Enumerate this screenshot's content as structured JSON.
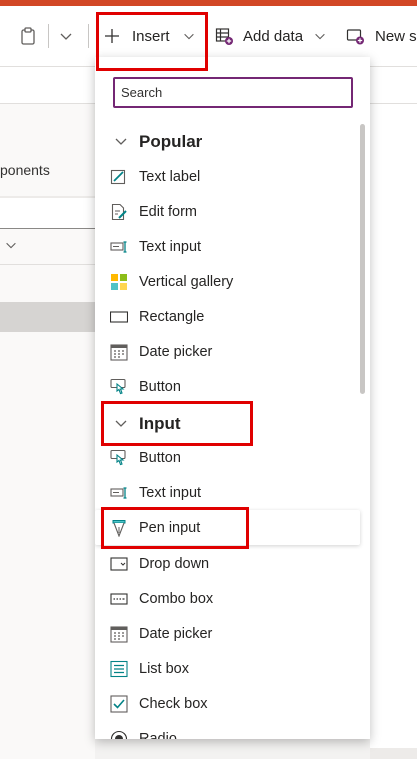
{
  "toolbar": {
    "insert_label": "Insert",
    "add_data_label": "Add data",
    "new_screen_label": "New s"
  },
  "left_panel": {
    "tab_label": "ponents"
  },
  "insert_menu": {
    "search_placeholder": "Search",
    "groups": [
      {
        "label": "Popular",
        "items": [
          {
            "label": "Text label",
            "icon": "text-label-icon"
          },
          {
            "label": "Edit form",
            "icon": "edit-form-icon"
          },
          {
            "label": "Text input",
            "icon": "text-input-icon"
          },
          {
            "label": "Vertical gallery",
            "icon": "vertical-gallery-icon"
          },
          {
            "label": "Rectangle",
            "icon": "rectangle-icon"
          },
          {
            "label": "Date picker",
            "icon": "date-picker-icon"
          },
          {
            "label": "Button",
            "icon": "button-icon"
          }
        ]
      },
      {
        "label": "Input",
        "items": [
          {
            "label": "Button",
            "icon": "button-icon"
          },
          {
            "label": "Text input",
            "icon": "text-input-icon"
          },
          {
            "label": "Pen input",
            "icon": "pen-input-icon"
          },
          {
            "label": "Drop down",
            "icon": "drop-down-icon"
          },
          {
            "label": "Combo box",
            "icon": "combo-box-icon"
          },
          {
            "label": "Date picker",
            "icon": "date-picker-icon"
          },
          {
            "label": "List box",
            "icon": "list-box-icon"
          },
          {
            "label": "Check box",
            "icon": "check-box-icon"
          },
          {
            "label": "Radio",
            "icon": "radio-icon"
          }
        ]
      }
    ]
  },
  "colors": {
    "brand": "#d24726",
    "focus_border": "#742774",
    "highlight": "#e00000",
    "icon_teal": "#038387"
  }
}
